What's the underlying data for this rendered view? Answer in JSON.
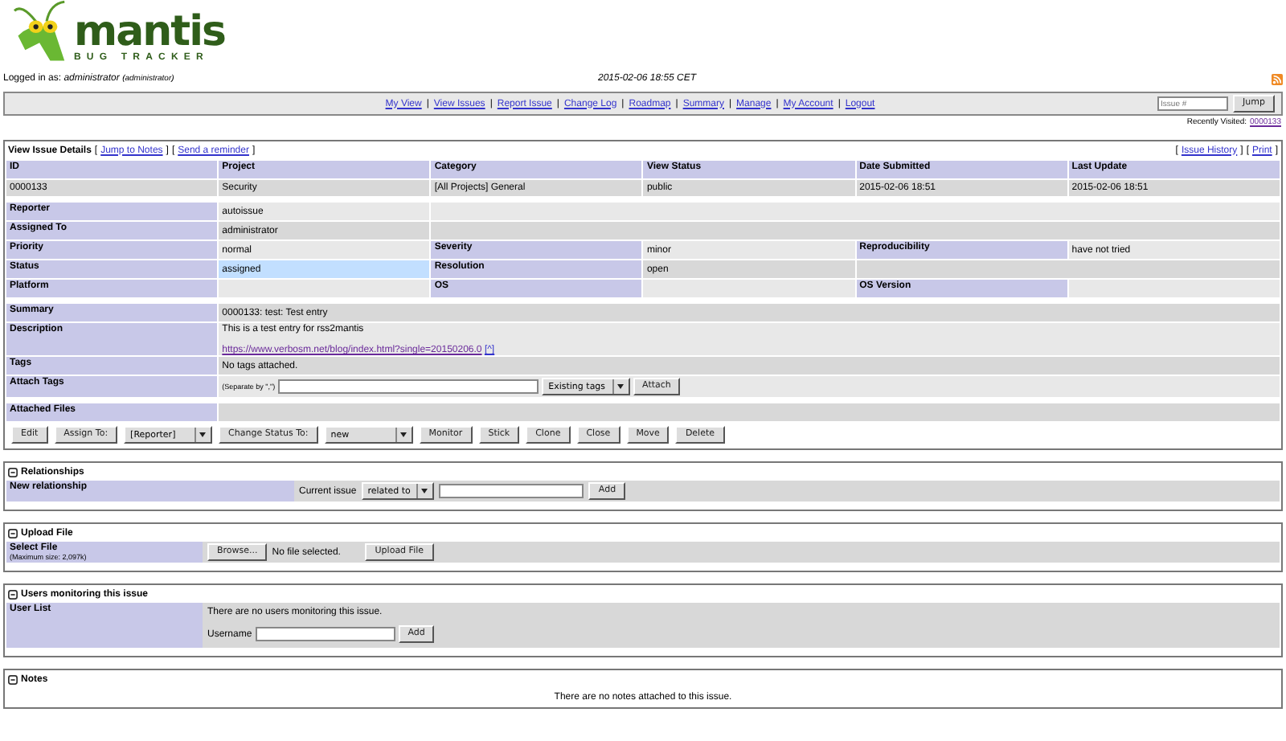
{
  "logo": {
    "title": "mantis",
    "subtitle": "BUG TRACKER"
  },
  "login": {
    "label": "Logged in as:",
    "user": "administrator",
    "role": "(administrator)",
    "datetime": "2015-02-06 18:55 CET"
  },
  "nav": [
    {
      "kind": "link",
      "text": "My View"
    },
    {
      "kind": "sep",
      "text": "|"
    },
    {
      "kind": "link",
      "text": "View Issues"
    },
    {
      "kind": "sep",
      "text": "|"
    },
    {
      "kind": "link",
      "text": "Report Issue"
    },
    {
      "kind": "sep",
      "text": "|"
    },
    {
      "kind": "link",
      "text": "Change Log"
    },
    {
      "kind": "sep",
      "text": "|"
    },
    {
      "kind": "link",
      "text": "Roadmap"
    },
    {
      "kind": "sep",
      "text": "|"
    },
    {
      "kind": "link",
      "text": "Summary"
    },
    {
      "kind": "sep",
      "text": "|"
    },
    {
      "kind": "link",
      "text": "Manage"
    },
    {
      "kind": "sep",
      "text": "|"
    },
    {
      "kind": "link",
      "text": "My Account"
    },
    {
      "kind": "sep",
      "text": "|"
    },
    {
      "kind": "link",
      "text": "Logout"
    }
  ],
  "jump": {
    "placeholder": "Issue #",
    "button": "Jump"
  },
  "recently_visited": {
    "label": "Recently Visited:",
    "issue": "0000133"
  },
  "issue": {
    "title": "View Issue Details",
    "toolbar_left": [
      {
        "kind": "text",
        "text": "["
      },
      {
        "kind": "link",
        "text": "Jump to Notes"
      },
      {
        "kind": "text",
        "text": "]"
      },
      {
        "kind": "text",
        "text": "["
      },
      {
        "kind": "link",
        "text": "Send a reminder"
      },
      {
        "kind": "text",
        "text": "]"
      }
    ],
    "toolbar_right": [
      {
        "kind": "text",
        "text": "["
      },
      {
        "kind": "link",
        "text": "Issue History"
      },
      {
        "kind": "text",
        "text": "]"
      },
      {
        "kind": "text",
        "text": "["
      },
      {
        "kind": "link",
        "text": "Print"
      },
      {
        "kind": "text",
        "text": "]"
      }
    ],
    "columns": [
      "ID",
      "Project",
      "Category",
      "View Status",
      "Date Submitted",
      "Last Update"
    ],
    "values": [
      "0000133",
      "Security",
      "[All Projects] General",
      "public",
      "2015-02-06 18:51",
      "2015-02-06 18:51"
    ],
    "groups": [
      [
        {
          "cells": [
            {
              "kind": "label",
              "text": "Reporter"
            },
            {
              "kind": "value",
              "text": "autoissue"
            },
            {
              "kind": "blank"
            }
          ]
        },
        {
          "cells": [
            {
              "kind": "label",
              "text": "Assigned To"
            },
            {
              "kind": "value",
              "text": "administrator"
            },
            {
              "kind": "blank"
            }
          ]
        },
        {
          "cells": [
            {
              "kind": "label",
              "text": "Priority"
            },
            {
              "kind": "value",
              "text": "normal"
            },
            {
              "kind": "label",
              "text": "Severity"
            },
            {
              "kind": "value",
              "text": "minor"
            },
            {
              "kind": "label",
              "text": "Reproducibility"
            },
            {
              "kind": "value",
              "text": "have not tried"
            }
          ]
        },
        {
          "cells": [
            {
              "kind": "label",
              "text": "Status"
            },
            {
              "kind": "value",
              "text": "assigned",
              "color": "#c2dfff"
            },
            {
              "kind": "label",
              "text": "Resolution"
            },
            {
              "kind": "value",
              "text": "open"
            },
            {
              "kind": "blank"
            }
          ]
        },
        {
          "cells": [
            {
              "kind": "label",
              "text": "Platform"
            },
            {
              "kind": "blank"
            },
            {
              "kind": "label",
              "text": "OS"
            },
            {
              "kind": "blank"
            },
            {
              "kind": "label",
              "text": "OS Version"
            },
            {
              "kind": "blank"
            }
          ]
        }
      ],
      [
        {
          "cells": [
            {
              "kind": "label",
              "text": "Summary"
            },
            {
              "kind": "value",
              "text": "0000133: test: Test entry"
            }
          ]
        },
        {
          "cells": [
            {
              "kind": "label",
              "text": "Description"
            },
            {
              "kind": "description",
              "text": "This is a test entry for rss2mantis",
              "link": "https://www.verbosm.net/blog/index.html?single=20150206.0",
              "suffix": "[^]"
            }
          ]
        },
        {
          "cells": [
            {
              "kind": "label",
              "text": "Tags"
            },
            {
              "kind": "value",
              "text": "No tags attached."
            }
          ]
        },
        {
          "cells": [
            {
              "kind": "label",
              "text": "Attach Tags"
            },
            {
              "kind": "tags",
              "hint": "(Separate by \",\")",
              "select": "Existing tags",
              "button": "Attach"
            }
          ]
        }
      ],
      [
        {
          "cells": [
            {
              "kind": "label",
              "text": "Attached Files"
            },
            {
              "kind": "blank"
            }
          ]
        }
      ]
    ],
    "actions": [
      {
        "kind": "button",
        "text": "Edit"
      },
      {
        "kind": "button",
        "text": "Assign To:"
      },
      {
        "kind": "select",
        "text": "[Reporter]"
      },
      {
        "kind": "button",
        "text": "Change Status To:"
      },
      {
        "kind": "select",
        "text": "new"
      },
      {
        "kind": "button",
        "text": "Monitor"
      },
      {
        "kind": "button",
        "text": "Stick"
      },
      {
        "kind": "button",
        "text": "Clone"
      },
      {
        "kind": "button",
        "text": "Close"
      },
      {
        "kind": "button",
        "text": "Move"
      },
      {
        "kind": "button",
        "text": "Delete"
      }
    ]
  },
  "relationships": {
    "title": "Relationships",
    "label": "New relationship",
    "prefix": "Current issue",
    "select": "related to",
    "button": "Add"
  },
  "upload": {
    "title": "Upload File",
    "label": "Select File",
    "note": "(Maximum size: 2,097k)",
    "browse": "Browse...",
    "status": "No file selected.",
    "button": "Upload File"
  },
  "monitoring": {
    "title": "Users monitoring this issue",
    "label": "User List",
    "message": "There are no users monitoring this issue.",
    "field_label": "Username",
    "button": "Add"
  },
  "notes": {
    "title": "Notes",
    "message": "There are no notes attached to this issue."
  }
}
